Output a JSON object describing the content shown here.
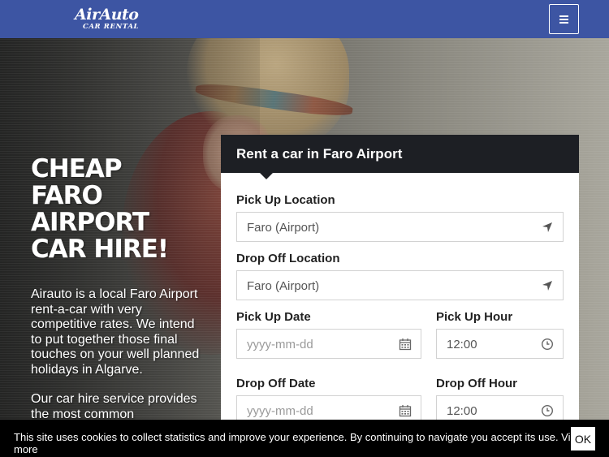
{
  "header": {
    "logo_brand": "AirAuto",
    "logo_sub": "CAR RENTAL",
    "menu_icon": "hamburger-menu-icon",
    "bg_color": "#3d55a3"
  },
  "hero": {
    "headline_lines": [
      "CHEAP",
      "FARO",
      "AIRPORT",
      "CAR HIRE!"
    ],
    "intro_p1": "Airauto is a local Faro Airport rent-a-car with very competitive rates. We intend to put together those final touches on your well planned holidays in Algarve.",
    "intro_p2": "Our car hire service provides the most common"
  },
  "form": {
    "title": "Rent a car in Faro Airport",
    "pickup_location_label": "Pick Up Location",
    "pickup_location_value": "Faro (Airport)",
    "dropoff_location_label": "Drop Off Location",
    "dropoff_location_value": "Faro (Airport)",
    "pickup_date_label": "Pick Up Date",
    "pickup_date_placeholder": "yyyy-mm-dd",
    "pickup_hour_label": "Pick Up Hour",
    "pickup_hour_value": "12:00",
    "dropoff_date_label": "Drop Off Date",
    "dropoff_date_placeholder": "yyyy-mm-dd",
    "dropoff_hour_label": "Drop Off Hour",
    "dropoff_hour_value": "12:00",
    "location_icon": "location-arrow-icon",
    "calendar_icon": "calendar-icon",
    "clock_icon": "clock-icon"
  },
  "cookie": {
    "message": "This site uses cookies to collect statistics and improve your experience. By continuing to navigate you accept its use. View more",
    "ok_label": "OK"
  }
}
